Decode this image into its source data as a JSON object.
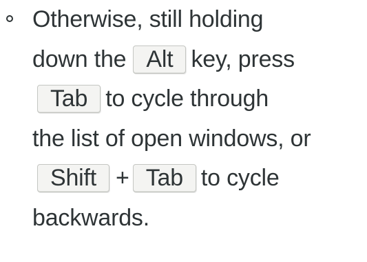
{
  "list_item": {
    "line1": "Otherwise, still holding",
    "line2_before": "down the",
    "key_alt": "Alt",
    "line2_after": "key, press",
    "key_tab_1": "Tab",
    "line3_after": "to cycle through",
    "line4": "the list of open windows, or",
    "key_shift": "Shift",
    "plus": "+",
    "key_tab_2": "Tab",
    "line5_after": "to cycle",
    "line6": "backwards."
  }
}
